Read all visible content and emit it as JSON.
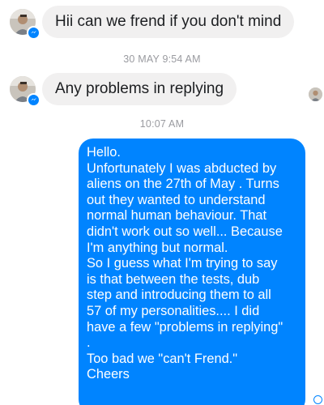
{
  "messages": {
    "incoming": [
      {
        "text": "Hii can we frend if you don't mind"
      },
      {
        "text": "Any problems in replying"
      }
    ],
    "timestamps": [
      "30 MAY 9:54 AM",
      "10:07 AM"
    ],
    "outgoing": {
      "lines": [
        "Hello.",
        "Unfortunately I was abducted by",
        "aliens on the 27th of May . Turns",
        "out they wanted to understand",
        "normal human behaviour. That",
        "didn't work out so well... Because",
        "I'm anything but normal.",
        "So I guess what I'm trying to say",
        "is that between the tests, dub",
        "step and introducing them to all",
        "57 of my personalities.... I did",
        "have a few \"problems in replying\"",
        ".",
        "Too bad we \"can't  Frend.\"",
        "Cheers"
      ]
    }
  },
  "colors": {
    "outgoing_bubble": "#0084ff",
    "incoming_bubble": "#f1f0f0",
    "timestamp_text": "#9a9ba0",
    "messenger_badge": "#0084ff"
  },
  "icons": {
    "sender_avatar": "profile-photo",
    "badge": "messenger-bolt-icon",
    "seen_indicator": "seen-avatar",
    "delivery_status": "sent-circle-icon"
  }
}
